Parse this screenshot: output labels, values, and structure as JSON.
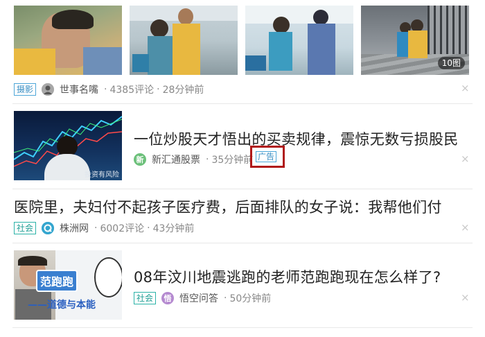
{
  "item1": {
    "photo_count": "10图",
    "tag": "摄影",
    "source": "世事名嘴",
    "comments": "4385评论",
    "time": "28分钟前",
    "close": "×"
  },
  "item2": {
    "title": "一位炒股天才悟出的买卖规律，震惊无数亏损股民",
    "thumb_caption": "投资有风险",
    "avatar_char": "新",
    "source": "新汇通股票",
    "time": "35分钟前",
    "ad_label": "广告",
    "ad_highlight_color": "#b01818",
    "close": "×"
  },
  "item3": {
    "title": "医院里，夫妇付不起孩子医疗费，后面排队的女子说：我帮他们付",
    "tag": "社会",
    "source": "株洲网",
    "comments": "6002评论",
    "time": "43分钟前",
    "close": "×"
  },
  "item4": {
    "title": "08年汶川地震逃跑的老师范跑跑现在怎么样了?",
    "thumb_text_top": "范跑跑",
    "thumb_text_bottom": "——道德与本能",
    "tag": "社会",
    "avatar_char": "悟",
    "source": "悟空问答",
    "time": "50分钟前",
    "close": "×"
  },
  "colors": {
    "tag_border": "#4ca6d8",
    "meta_text": "#888888",
    "title_text": "#222222"
  }
}
